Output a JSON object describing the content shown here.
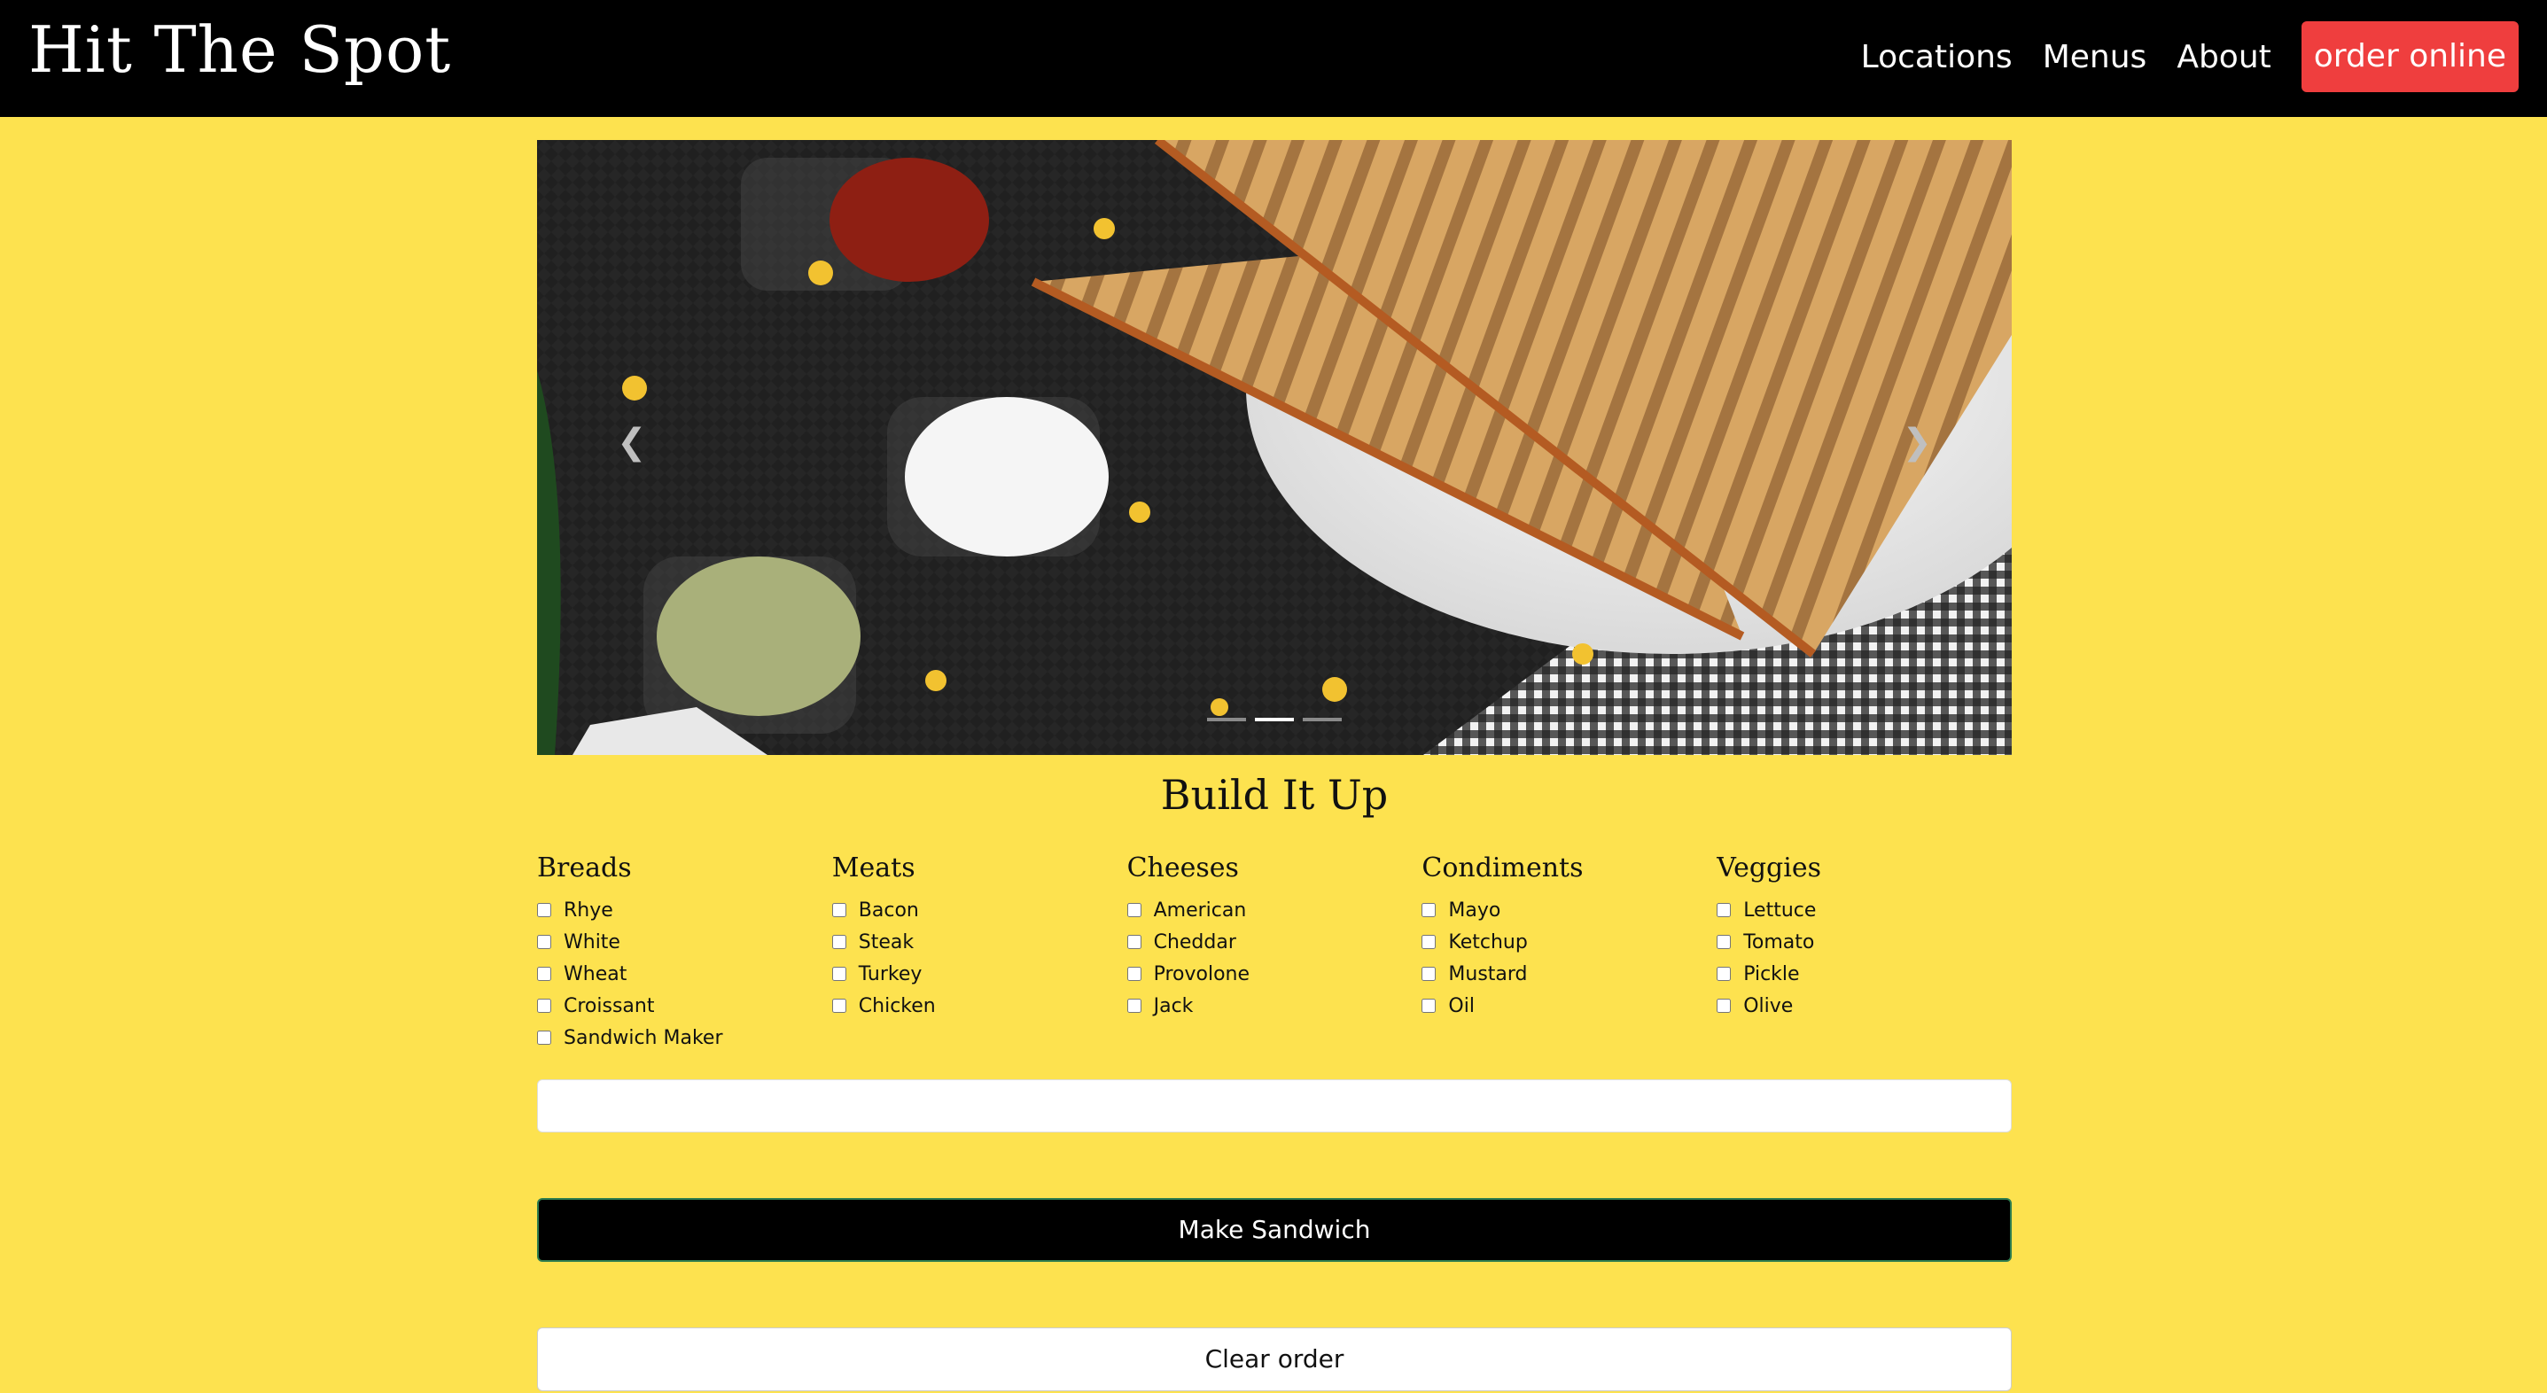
{
  "header": {
    "brand": "Hit The Spot",
    "nav": {
      "locations": "Locations",
      "menus": "Menus",
      "about": "About",
      "order": "order online"
    },
    "accent": "#ef3e3e"
  },
  "carousel": {
    "prev_icon": "chevron-left-icon",
    "next_icon": "chevron-right-icon",
    "slides": 3,
    "active_slide": 2
  },
  "builder": {
    "title": "Build It Up",
    "categories": [
      {
        "name": "Breads",
        "items": [
          "Rhye",
          "White",
          "Wheat",
          "Croissant",
          "Sandwich Maker"
        ]
      },
      {
        "name": "Meats",
        "items": [
          "Bacon",
          "Steak",
          "Turkey",
          "Chicken"
        ]
      },
      {
        "name": "Cheeses",
        "items": [
          "American",
          "Cheddar",
          "Provolone",
          "Jack"
        ]
      },
      {
        "name": "Condiments",
        "items": [
          "Mayo",
          "Ketchup",
          "Mustard",
          "Oil"
        ]
      },
      {
        "name": "Veggies",
        "items": [
          "Lettuce",
          "Tomato",
          "Pickle",
          "Olive"
        ]
      }
    ],
    "order_field_value": "",
    "make_label": "Make Sandwich",
    "clear_label": "Clear order"
  },
  "colors": {
    "background": "#fde24f",
    "header": "#000000"
  }
}
